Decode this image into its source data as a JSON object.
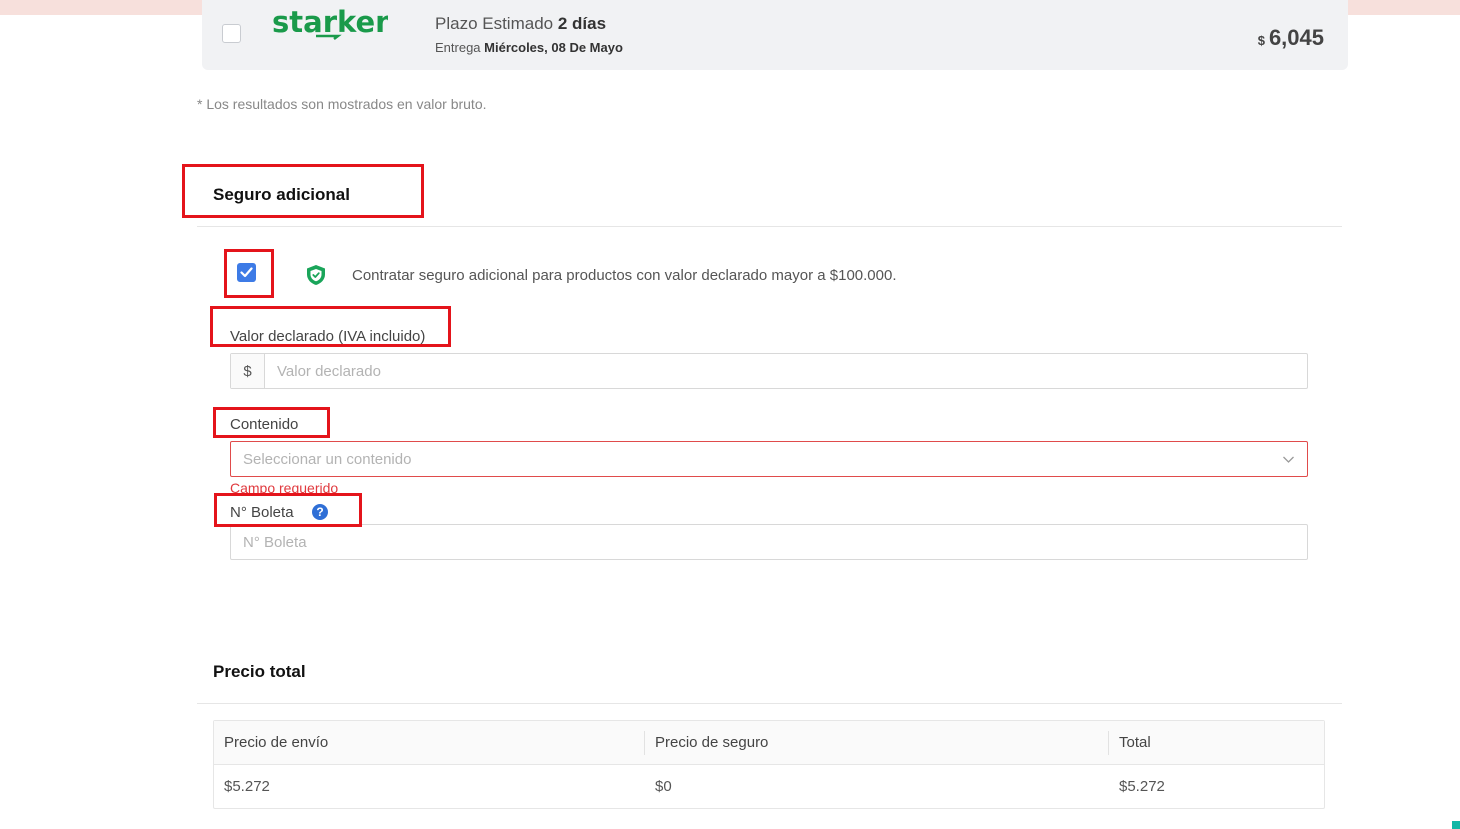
{
  "carrier": {
    "logo_text": "starken",
    "plazo_label": "Plazo Estimado",
    "plazo_value": "2 días",
    "entrega_label": "Entrega",
    "entrega_value": "Miércoles, 08 De Mayo",
    "currency": "$",
    "price": "6,045"
  },
  "footnote": "* Los resultados son mostrados en valor bruto.",
  "insurance": {
    "title": "Seguro adicional",
    "checkbox_checked": true,
    "checkbox_label": "Contratar seguro adicional para productos con valor declarado mayor a $100.000.",
    "declared_value": {
      "label": "Valor declarado (IVA incluido)",
      "prefix": "$",
      "placeholder": "Valor declarado",
      "value": ""
    },
    "content": {
      "label": "Contenido",
      "placeholder": "Seleccionar un contenido",
      "error": "Campo requerido"
    },
    "boleta": {
      "label": "N° Boleta",
      "help": "?",
      "placeholder": "N° Boleta",
      "value": ""
    }
  },
  "total": {
    "title": "Precio total",
    "columns": [
      "Precio de envío",
      "Precio de seguro",
      "Total"
    ],
    "row": [
      "$5.272",
      "$0",
      "$5.272"
    ]
  },
  "colors": {
    "brand_green": "#1a9a4a",
    "checkbox_blue": "#3d7be6",
    "error_red": "#e0393e",
    "annotation_red": "#e4141b"
  }
}
